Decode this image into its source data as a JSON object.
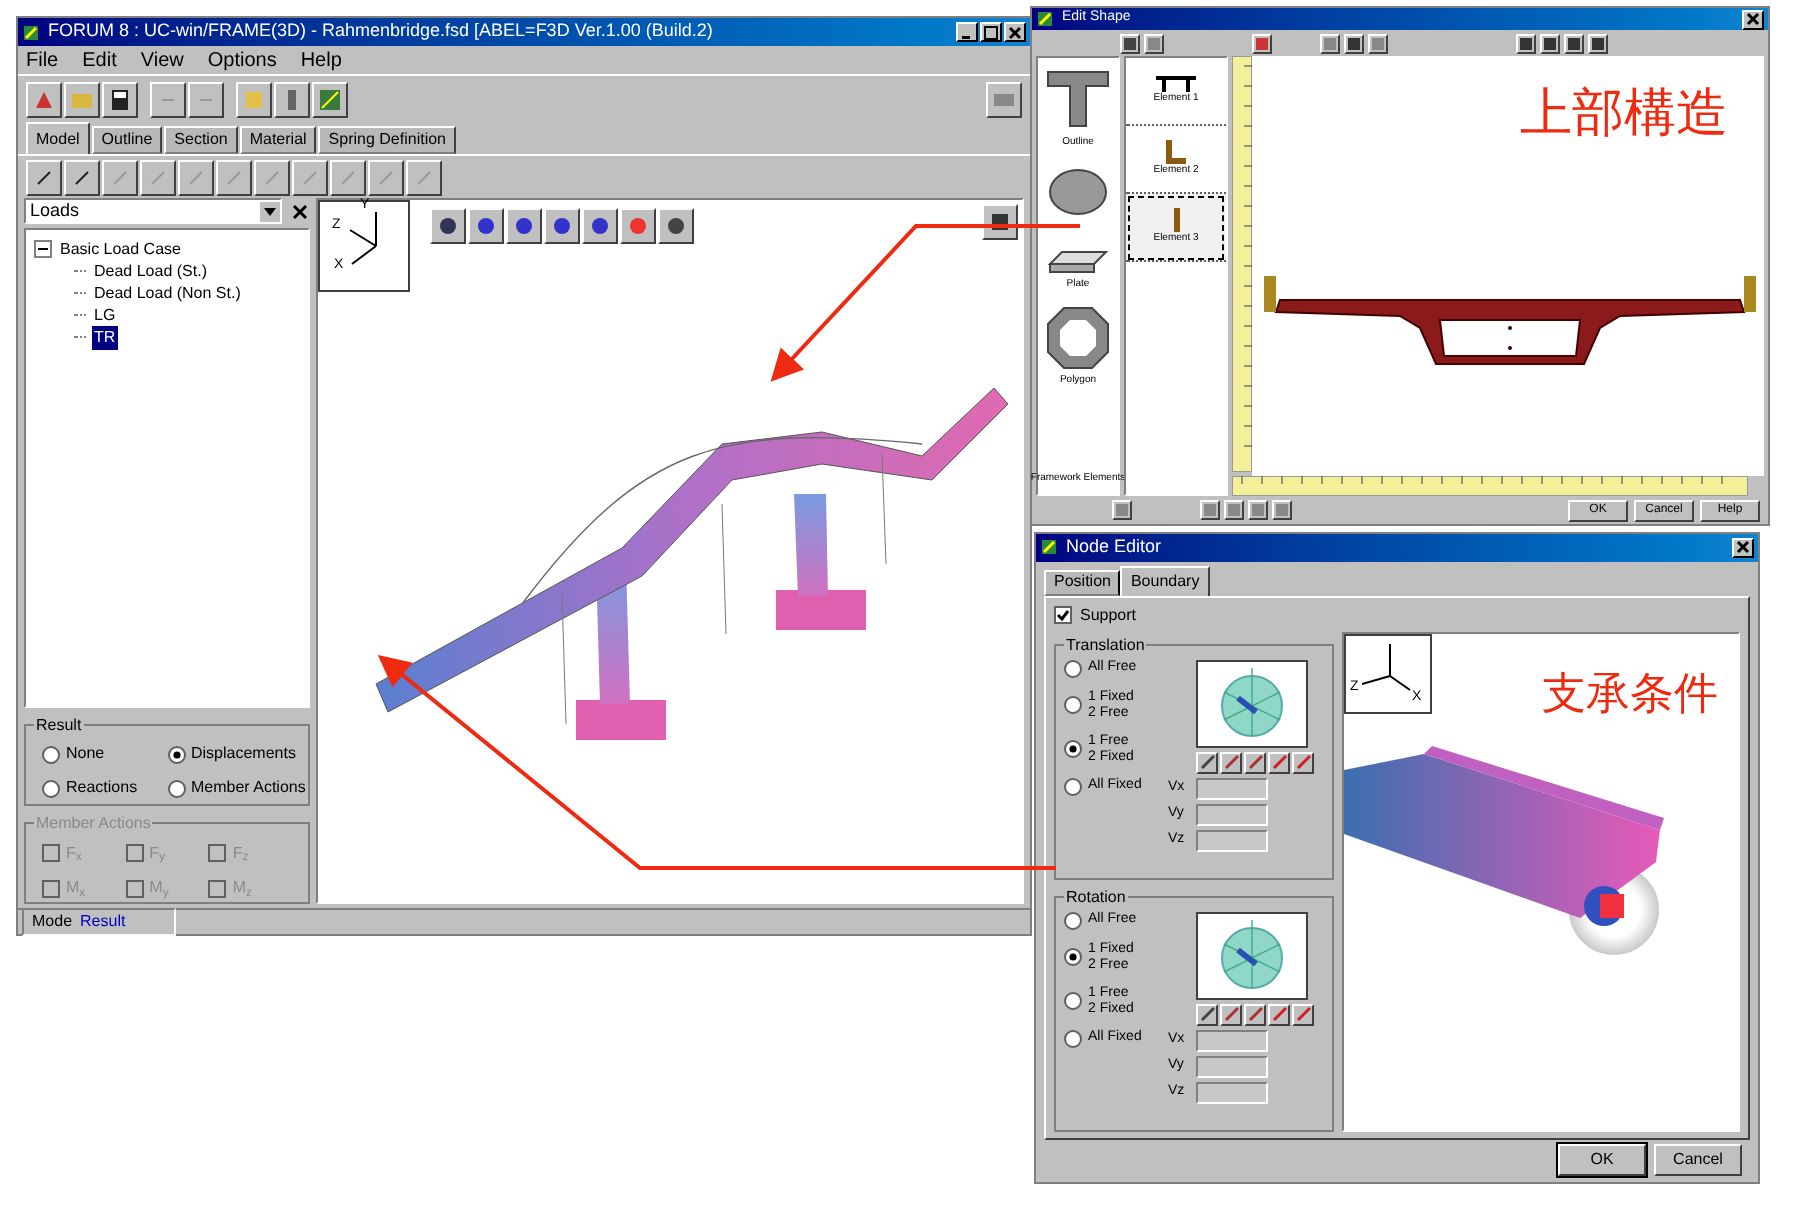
{
  "main_window": {
    "title": "FORUM 8 : UC-win/FRAME(3D) - Rahmenbridge.fsd   [ABEL=F3D Ver.1.00 (Build.2)",
    "menu": [
      "File",
      "Edit",
      "View",
      "Options",
      "Help"
    ],
    "tabs": [
      {
        "label": "Model",
        "selected": true
      },
      {
        "label": "Outline",
        "selected": false
      },
      {
        "label": "Section",
        "selected": false
      },
      {
        "label": "Material",
        "selected": false
      },
      {
        "label": "Spring Definition",
        "selected": false
      }
    ],
    "load_selector": {
      "value": "Loads"
    },
    "tree": [
      {
        "label": "Basic Load Case",
        "expanded": true,
        "selected": false,
        "children": [
          {
            "label": "Dead Load (St.)",
            "selected": false
          },
          {
            "label": "Dead Load (Non St.)",
            "selected": false
          },
          {
            "label": "LG",
            "selected": false
          },
          {
            "label": "TR",
            "selected": true
          }
        ]
      }
    ],
    "result": {
      "title": "Result",
      "options": [
        {
          "label": "None",
          "selected": false
        },
        {
          "label": "Displacements",
          "selected": true
        },
        {
          "label": "Reactions",
          "selected": false
        },
        {
          "label": "Member Actions",
          "selected": false
        }
      ]
    },
    "member_actions": {
      "title": "Member Actions",
      "disabled": true,
      "items": [
        {
          "label": "F$_{x}$",
          "checked": false
        },
        {
          "label": "F$_{y}$",
          "checked": false
        },
        {
          "label": "F$_{z}$",
          "checked": false
        },
        {
          "label": "M$_{x}$",
          "checked": false
        },
        {
          "label": "M$_{y}$",
          "checked": false
        },
        {
          "label": "M$_{z}$",
          "checked": false
        }
      ]
    },
    "status_bar": {
      "label": "Mode",
      "value": "Result"
    },
    "view_axes": [
      "Y",
      "Z",
      "X"
    ]
  },
  "section_window": {
    "title": "Edit Shape",
    "palette": [
      "Outline",
      "Plate",
      "Polygon",
      "Framework Elements"
    ],
    "elements": [
      {
        "label": "Element 1",
        "selected": false
      },
      {
        "label": "Element 2",
        "selected": false
      },
      {
        "label": "Element 3",
        "selected": true
      }
    ],
    "caption": "上部構造",
    "buttons": [
      "OK",
      "Cancel",
      "Help"
    ]
  },
  "node_editor": {
    "title": "Node Editor",
    "tabs": [
      {
        "label": "Position",
        "selected": false
      },
      {
        "label": "Boundary",
        "selected": true
      }
    ],
    "support": {
      "label": "Support",
      "checked": true
    },
    "groups": [
      {
        "title": "Translation",
        "options": [
          {
            "label": "All Free",
            "selected": false
          },
          {
            "label": "1 Fixed\n2 Free",
            "selected": false
          },
          {
            "label": "1 Free\n2 Fixed",
            "selected": true
          },
          {
            "label": "All Fixed",
            "selected": false
          }
        ],
        "fields": [
          "Vx",
          "Vy",
          "Vz"
        ]
      },
      {
        "title": "Rotation",
        "options": [
          {
            "label": "All Free",
            "selected": false
          },
          {
            "label": "1 Fixed\n2 Free",
            "selected": true
          },
          {
            "label": "1 Free\n2 Fixed",
            "selected": false
          },
          {
            "label": "All Fixed",
            "selected": false
          }
        ],
        "fields": [
          "Vx",
          "Vy",
          "Vz"
        ]
      }
    ],
    "preview_axes": [
      "Z",
      "X"
    ],
    "caption": "支承条件",
    "buttons": [
      "OK",
      "Cancel"
    ]
  }
}
